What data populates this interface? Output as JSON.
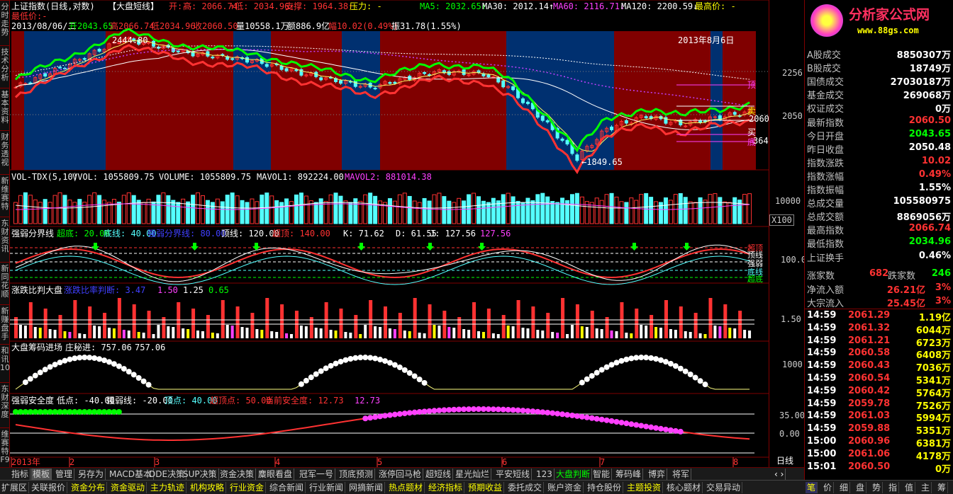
{
  "colors": {
    "red": "#ff3232",
    "green": "#00ff00",
    "cyan": "#54ffff",
    "yellow": "#ffff00",
    "magenta": "#ff40ff",
    "white": "#ffffff",
    "bgred": "#800000",
    "bgblue": "#003070"
  },
  "header": {
    "line1": [
      "上证指数(日线,对数)",
      "【大盘短线】",
      "开",
      "-",
      "高",
      "2066.74",
      "低",
      "2034.96",
      "支撑",
      "1964.38",
      "压力",
      "-",
      "MA5",
      "2032.65",
      "MA30",
      "2012.14",
      "MA60",
      "2116.71",
      "MA120",
      "2200.59",
      "最高价",
      "-"
    ],
    "line1b": "最低价:-",
    "line2": [
      "2013/08/06/二",
      "开2043.65",
      "高2066.74",
      "低2034.96",
      "收2060.50",
      "量10558.1万",
      "额886.9亿",
      "幅10.02(0.49%)",
      "振31.78(1.55%)"
    ],
    "date_overlay": "2013年8月6日",
    "peak_label": "2444.80",
    "low_label": "1849.65",
    "right_labels": [
      "2256",
      "2050",
      "2060",
      "顶",
      "卖",
      "买",
      "底",
      "364"
    ]
  },
  "vol": {
    "title": "VOL-TDX(5,10)",
    "vvol": "VVOL: 1055809.75",
    "volume": "VOLUME: 1055809.75",
    "mavol1": "MAVOL1: 892224.00",
    "mavol2": "MAVOL2: 881014.38",
    "axis": "10000",
    "unit": "X100"
  },
  "kdj": {
    "title": "强弱分界线",
    "chaodi": "超底: 20.00",
    "didi": "底线: 40.00",
    "qiangruo": "强弱分界线: 80.00",
    "dingxian": "顶线: 120.00",
    "chaoding": "超顶: 140.00",
    "k": "K: 71.62",
    "d": "D: 61.55",
    "j": "J: 127.56",
    "j2": "127.56",
    "axis": "100.0",
    "tags": [
      "超顶",
      "顶线",
      "强弱",
      "底线",
      "超底"
    ]
  },
  "ratio": {
    "title": "涨跌比判大盘",
    "sub": "涨跌比率判断: 3.47",
    "a": "1.50",
    "b": "1.25",
    "c": "0.65",
    "axis": "1.50"
  },
  "chip": {
    "title": "大盘筹码进场",
    "a": "庄秘进: 757.06",
    "b": "757.06",
    "axis": "1000"
  },
  "safe": {
    "title": "强弱安全度",
    "a": "低点: -40.00",
    "b": "强弱线: -20.00",
    "c": "顶点: 40.00",
    "d": "超顶点: 50.00",
    "e": "当前安全度: 12.73",
    "f": "12.73",
    "ax1": "35.00",
    "ax2": "0.00"
  },
  "xaxis": [
    "2013年",
    "2",
    "3",
    "4",
    "5",
    "6",
    "7",
    "8"
  ],
  "period": "日线",
  "sidebar": [
    "分时走势",
    "技术分析",
    "基本资料",
    "财务透视",
    "新维赛特",
    "东财资讯",
    "新同花顺",
    "新赚盘手",
    "和讯10",
    "东财深度",
    "维赛特F9"
  ],
  "logo": {
    "title": "分析家公式网",
    "url": "www.88gs.com"
  },
  "quote": [
    {
      "k": "A股成交",
      "v": "8850307万",
      "c": "#ffffff"
    },
    {
      "k": "B股成交",
      "v": "18749万",
      "c": "#ffffff"
    },
    {
      "k": "国债成交",
      "v": "27030187万",
      "c": "#ffffff"
    },
    {
      "k": "基金成交",
      "v": "269068万",
      "c": "#ffffff"
    },
    {
      "k": "权证成交",
      "v": "0万",
      "c": "#ffffff"
    },
    {
      "k": "最新指数",
      "v": "2060.50",
      "c": "#ff3232"
    },
    {
      "k": "今日开盘",
      "v": "2043.65",
      "c": "#00ff00"
    },
    {
      "k": "昨日收盘",
      "v": "2050.48",
      "c": "#ffffff"
    },
    {
      "k": "指数涨跌",
      "v": "10.02",
      "c": "#ff3232"
    },
    {
      "k": "指数涨幅",
      "v": "0.49%",
      "c": "#ff3232"
    },
    {
      "k": "指数振幅",
      "v": "1.55%",
      "c": "#ffffff"
    },
    {
      "k": "总成交量",
      "v": "105580975",
      "c": "#ffffff"
    },
    {
      "k": "总成交额",
      "v": "8869056万",
      "c": "#ffffff"
    },
    {
      "k": "最高指数",
      "v": "2066.74",
      "c": "#ff3232"
    },
    {
      "k": "最低指数",
      "v": "2034.96",
      "c": "#00ff00"
    },
    {
      "k": "上证换手",
      "v": "0.46%",
      "c": "#ffffff"
    }
  ],
  "breadth": {
    "up_label": "涨家数",
    "up": "682",
    "down_label": "跌家数",
    "down": "246"
  },
  "flow": [
    {
      "k": "净流入额",
      "v": "26.21亿",
      "p": "3%"
    },
    {
      "k": "大宗流入",
      "v": "25.45亿",
      "p": "3%"
    }
  ],
  "ticks": [
    {
      "t": "14:59",
      "p": "2061.29",
      "v": "1.19亿"
    },
    {
      "t": "14:59",
      "p": "2061.32",
      "v": "6044万"
    },
    {
      "t": "14:59",
      "p": "2061.21",
      "v": "6723万"
    },
    {
      "t": "14:59",
      "p": "2060.58",
      "v": "6408万"
    },
    {
      "t": "14:59",
      "p": "2060.43",
      "v": "7036万"
    },
    {
      "t": "14:59",
      "p": "2060.54",
      "v": "5341万"
    },
    {
      "t": "14:59",
      "p": "2060.42",
      "v": "5764万"
    },
    {
      "t": "14:59",
      "p": "2059.78",
      "v": "7526万"
    },
    {
      "t": "14:59",
      "p": "2061.03",
      "v": "5994万"
    },
    {
      "t": "14:59",
      "p": "2059.88",
      "v": "5351万"
    },
    {
      "t": "15:00",
      "p": "2060.96",
      "v": "6381万"
    },
    {
      "t": "15:00",
      "p": "2061.06",
      "v": "4178万"
    },
    {
      "t": "15:01",
      "p": "2060.50",
      "v": "0万"
    }
  ],
  "tabs1": [
    "指标",
    "模板",
    "管理",
    "另存为",
    "MACD基本",
    "DDE决策",
    "SUP决策",
    "资金决策",
    "麋眼看盘",
    "冠军一号",
    "顶底预测",
    "涨停回马枪",
    "超短线",
    "星光灿烂",
    "平安短线",
    "123",
    "大盘判断",
    "智能",
    "筹码峰",
    "博弈",
    "将军"
  ],
  "tabs2": [
    "扩展区",
    "关联报价",
    "资金分布",
    "资金驱动",
    "主力轨迹",
    "机构攻略",
    "行业资金",
    "综合新闻",
    "行业新闻",
    "网摘新闻",
    "热点题材",
    "经济指标",
    "预期收益",
    "委托成交",
    "账户资金",
    "持仓股份",
    "主题投资",
    "核心题材",
    "交易异动"
  ],
  "bottom_right": [
    "笔",
    "价",
    "细",
    "盘",
    "势",
    "指",
    "值",
    "主",
    "筹"
  ]
}
